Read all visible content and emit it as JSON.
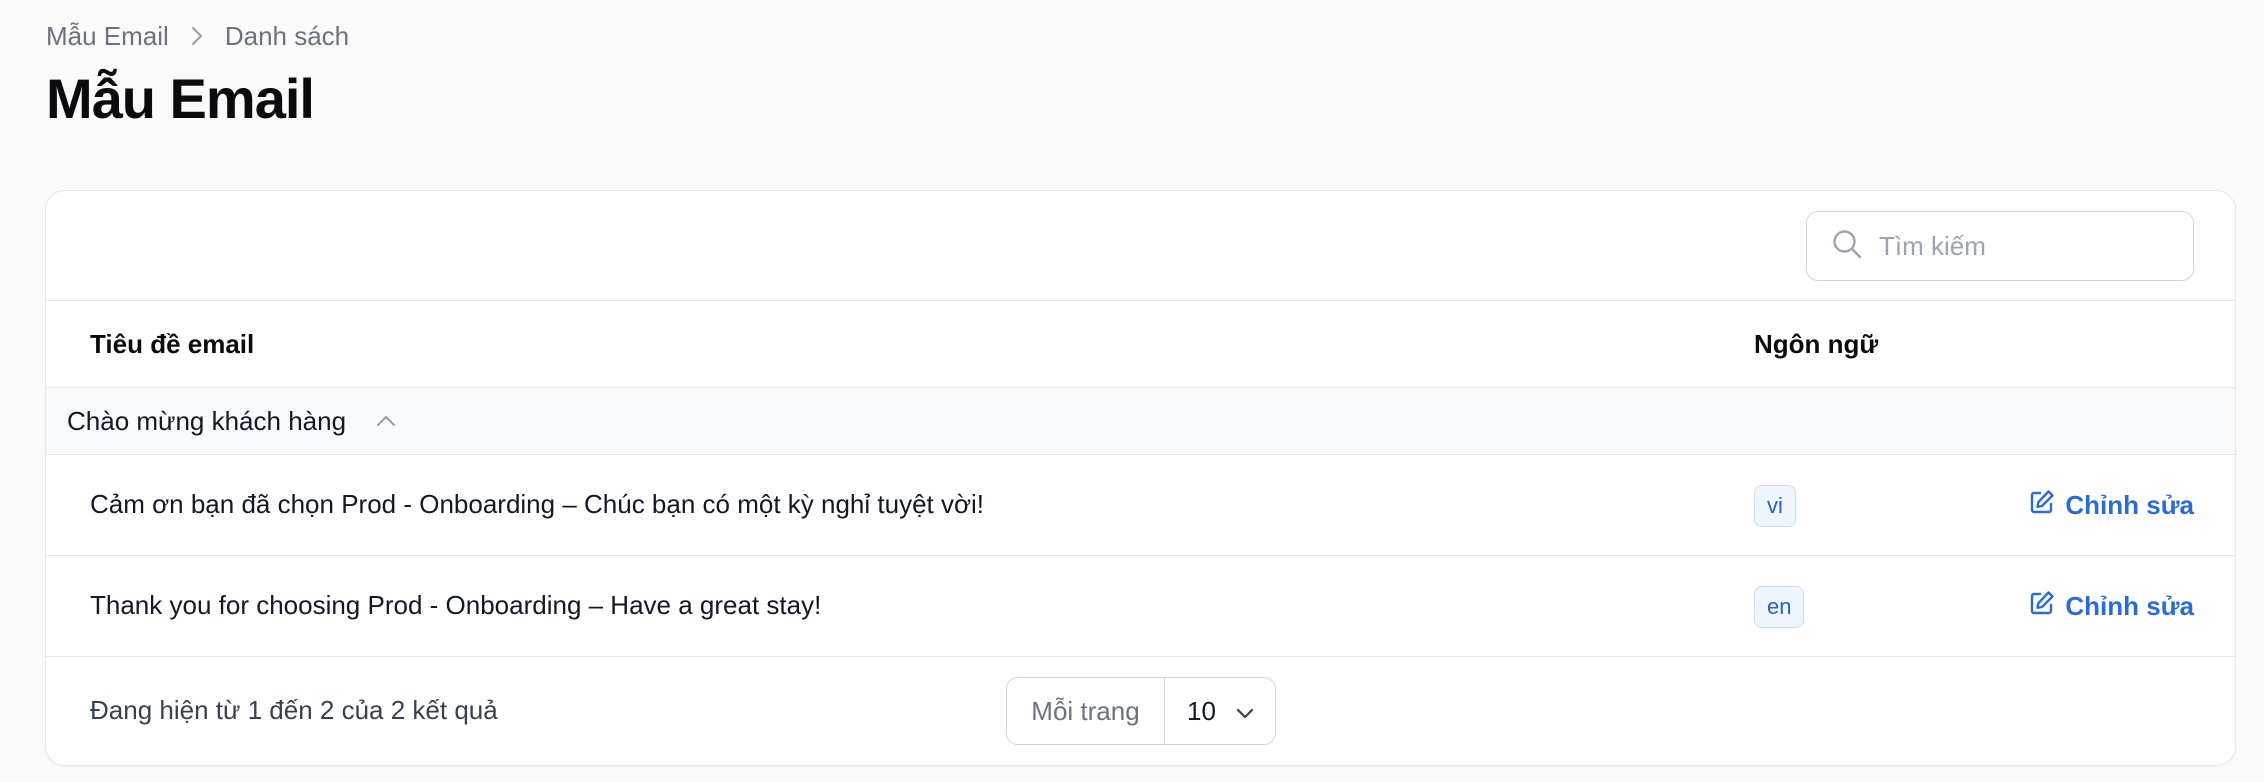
{
  "breadcrumb": {
    "parent": "Mẫu Email",
    "current": "Danh sách"
  },
  "page": {
    "title": "Mẫu Email"
  },
  "search": {
    "placeholder": "Tìm kiếm"
  },
  "table": {
    "columns": {
      "title": "Tiêu đề email",
      "language": "Ngôn ngữ"
    },
    "group": {
      "label": "Chào mừng khách hàng"
    },
    "rows": [
      {
        "title": "Cảm ơn bạn đã chọn Prod - Onboarding – Chúc bạn có một kỳ nghỉ tuyệt vời!",
        "language": "vi",
        "action": "Chỉnh sửa"
      },
      {
        "title": "Thank you for choosing Prod - Onboarding – Have a great stay!",
        "language": "en",
        "action": "Chỉnh sửa"
      }
    ]
  },
  "footer": {
    "summary": "Đang hiện từ 1 đến 2 của 2 kết quả",
    "per_page_label": "Mỗi trang",
    "per_page_value": "10"
  },
  "colors": {
    "accent": "#2b6cd1",
    "badge_bg": "#eef5fd",
    "background": "#fafafa"
  },
  "icons": {
    "breadcrumb_separator": "chevron-right-icon",
    "search": "search-icon",
    "group_toggle": "chevron-up-icon",
    "edit": "edit-icon",
    "select": "chevron-down-icon"
  }
}
